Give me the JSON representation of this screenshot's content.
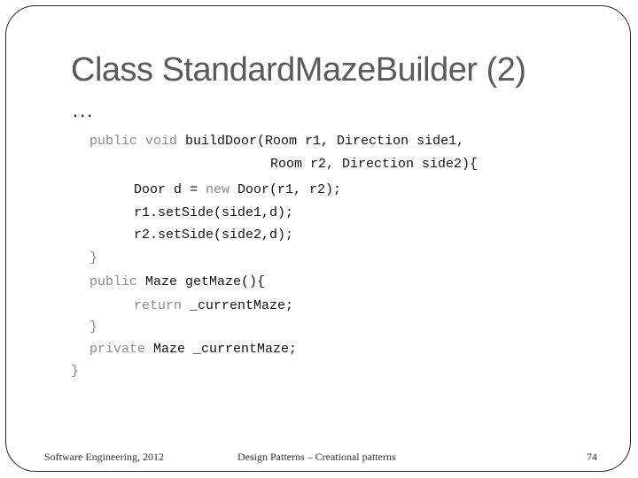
{
  "slide": {
    "title": "Class StandardMazeBuilder (2)",
    "ellipsis": "...",
    "code": [
      {
        "kw": "public void ",
        "text": "buildDoor(Room r1, Direction side1,"
      },
      {
        "kw": "",
        "text": "Room r2, Direction side2){"
      },
      {
        "pre": "Door d = ",
        "kw": "new ",
        "text": "Door(r1, r2);"
      },
      {
        "kw": "",
        "text": "r1.setSide(side1,d);"
      },
      {
        "kw": "",
        "text": "r2.setSide(side2,d);"
      },
      {
        "kw": "",
        "text": "}"
      },
      {
        "kw": "public ",
        "text": "Maze getMaze(){"
      },
      {
        "kw": "return ",
        "text": "_currentMaze;"
      },
      {
        "kw": "",
        "text": "}"
      },
      {
        "kw": "private ",
        "text": "Maze _currentMaze;"
      },
      {
        "kw": "",
        "text": "}"
      }
    ]
  },
  "footer": {
    "left": "Software Engineering, 2012",
    "center": "Design Patterns – Creational patterns",
    "page_number": "74"
  }
}
